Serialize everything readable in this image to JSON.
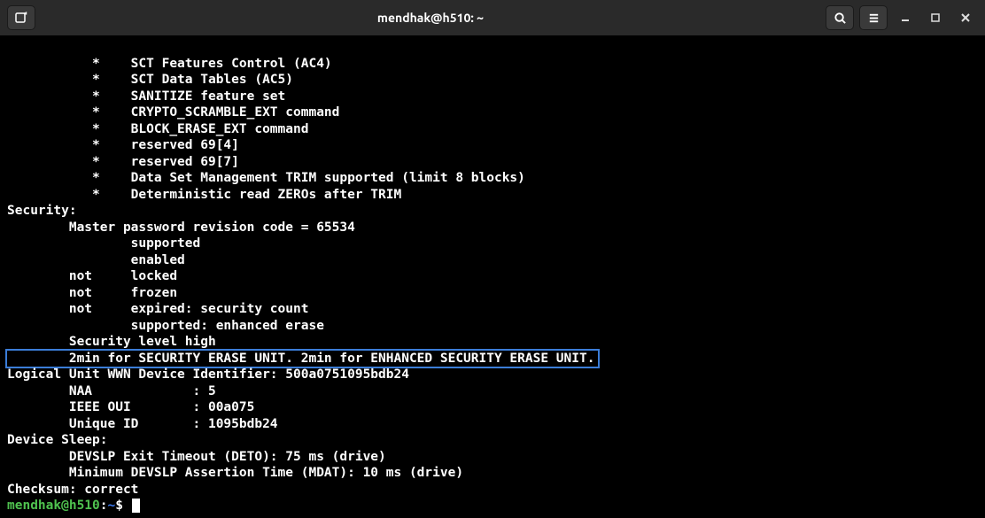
{
  "titlebar": {
    "title": "mendhak@h510: ~"
  },
  "terminal": {
    "lines": [
      "           *    SCT Features Control (AC4)",
      "           *    SCT Data Tables (AC5)",
      "           *    SANITIZE feature set",
      "           *    CRYPTO_SCRAMBLE_EXT command",
      "           *    BLOCK_ERASE_EXT command",
      "           *    reserved 69[4]",
      "           *    reserved 69[7]",
      "           *    Data Set Management TRIM supported (limit 8 blocks)",
      "           *    Deterministic read ZEROs after TRIM",
      "Security: ",
      "        Master password revision code = 65534",
      "                supported",
      "                enabled",
      "        not     locked",
      "        not     frozen",
      "        not     expired: security count",
      "                supported: enhanced erase",
      "        Security level high"
    ],
    "highlighted_line": "        2min for SECURITY ERASE UNIT. 2min for ENHANCED SECURITY ERASE UNIT.",
    "lines_after": [
      "Logical Unit WWN Device Identifier: 500a0751095bdb24",
      "        NAA             : 5",
      "        IEEE OUI        : 00a075",
      "        Unique ID       : 1095bdb24",
      "Device Sleep:",
      "        DEVSLP Exit Timeout (DETO): 75 ms (drive)",
      "        Minimum DEVSLP Assertion Time (MDAT): 10 ms (drive)",
      "Checksum: correct"
    ],
    "prompt": {
      "user_host": "mendhak@h510",
      "path": "~",
      "symbol": "$"
    }
  }
}
